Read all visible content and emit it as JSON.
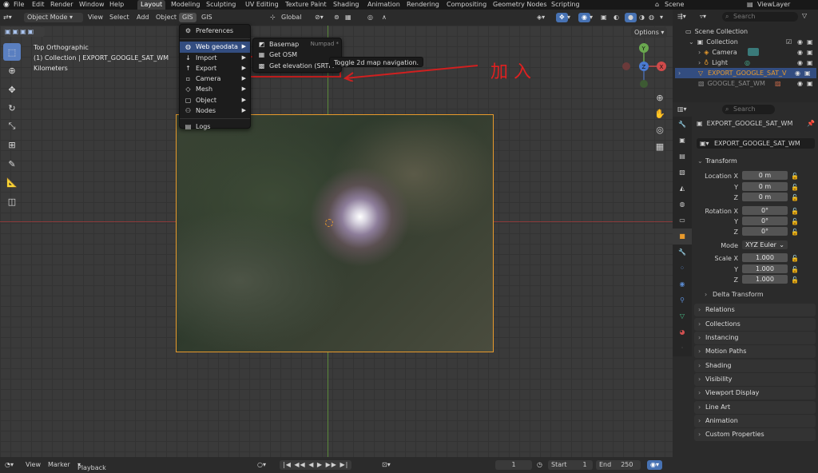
{
  "topbar": {
    "menus": [
      "File",
      "Edit",
      "Render",
      "Window",
      "Help"
    ],
    "tabs": [
      "Layout",
      "Modeling",
      "Sculpting",
      "UV Editing",
      "Texture Paint",
      "Shading",
      "Animation",
      "Rendering",
      "Compositing",
      "Geometry Nodes",
      "Scripting"
    ],
    "active_tab": "Layout",
    "scene": "Scene",
    "view_layer": "ViewLayer"
  },
  "header": {
    "mode": "Object Mode",
    "menus": [
      "View",
      "Select",
      "Add",
      "Object",
      "GIS",
      "GIS"
    ],
    "orientation": "Global",
    "options": "Options"
  },
  "viewport": {
    "view_name": "Top Orthographic",
    "collection_info": "(1) Collection | EXPORT_GOOGLE_SAT_WM",
    "units": "Kilometers",
    "annotation": "加 入",
    "gizmo": {
      "x": "X",
      "y": "Y",
      "z": "Z"
    }
  },
  "gis_menu": {
    "items": [
      "Preferences",
      "Web geodata",
      "Import",
      "Export",
      "Camera",
      "Mesh",
      "Object",
      "Nodes",
      "Logs"
    ]
  },
  "web_geodata_menu": {
    "items": [
      "Basemap",
      "Get OSM",
      "Get elevation (SRTM"
    ],
    "basemap_shortcut": "Numpad *",
    "tooltip": "Toggle 2d map navigation."
  },
  "outliner": {
    "search_placeholder": "Search",
    "root": "Scene Collection",
    "items": [
      "Collection",
      "Camera",
      "Light",
      "EXPORT_GOOGLE_SAT_V",
      "GOOGLE_SAT_WM"
    ]
  },
  "properties": {
    "search_placeholder": "Search",
    "object_name": "EXPORT_GOOGLE_SAT_WM",
    "object_field": "EXPORT_GOOGLE_SAT_WM",
    "transform_title": "Transform",
    "location_x_label": "Location X",
    "rotation_x_label": "Rotation X",
    "scale_x_label": "Scale X",
    "y_label": "Y",
    "z_label": "Z",
    "mode_label": "Mode",
    "location": [
      "0 m",
      "0 m",
      "0 m"
    ],
    "rotation": [
      "0°",
      "0°",
      "0°"
    ],
    "mode": "XYZ Euler",
    "scale": [
      "1.000",
      "1.000",
      "1.000"
    ],
    "delta_transform": "Delta Transform",
    "panels": [
      "Relations",
      "Collections",
      "Instancing",
      "Motion Paths",
      "Shading",
      "Visibility",
      "Viewport Display",
      "Line Art",
      "Animation",
      "Custom Properties"
    ]
  },
  "timeline": {
    "view": "View",
    "marker": "Marker",
    "playback": "Playback",
    "current_frame": "1",
    "start_label": "Start",
    "start": "1",
    "end_label": "End",
    "end": "250"
  }
}
